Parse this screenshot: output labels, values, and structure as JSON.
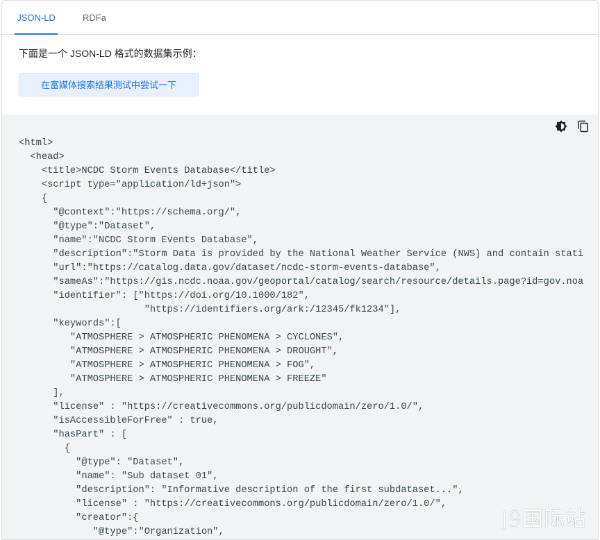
{
  "tabs": [
    {
      "label": "JSON-LD",
      "active": true
    },
    {
      "label": "RDFa",
      "active": false
    }
  ],
  "intro_text": "下面是一个 JSON-LD 格式的数据集示例：",
  "try_button_label": "在富媒体搜索结果测试中尝试一下",
  "toolbar": {
    "theme_icon": "brightness-icon",
    "copy_icon": "copy-icon"
  },
  "code_lines": [
    "<html>",
    "  <head>",
    "    <title>NCDC Storm Events Database</title>",
    "    <script type=\"application/ld+json\">",
    "    {",
    "      \"@context\":\"https://schema.org/\",",
    "      \"@type\":\"Dataset\",",
    "      \"name\":\"NCDC Storm Events Database\",",
    "      \"description\":\"Storm Data is provided by the National Weather Service (NWS) and contain stati",
    "      \"url\":\"https://catalog.data.gov/dataset/ncdc-storm-events-database\",",
    "      \"sameAs\":\"https://gis.ncdc.noaa.gov/geoportal/catalog/search/resource/details.page?id=gov.noa",
    "      \"identifier\": [\"https://doi.org/10.1000/182\",",
    "                      \"https://identifiers.org/ark:/12345/fk1234\"],",
    "      \"keywords\":[",
    "         \"ATMOSPHERE > ATMOSPHERIC PHENOMENA > CYCLONES\",",
    "         \"ATMOSPHERE > ATMOSPHERIC PHENOMENA > DROUGHT\",",
    "         \"ATMOSPHERE > ATMOSPHERIC PHENOMENA > FOG\",",
    "         \"ATMOSPHERE > ATMOSPHERIC PHENOMENA > FREEZE\"",
    "      ],",
    "      \"license\" : \"https://creativecommons.org/publicdomain/zero/1.0/\",",
    "      \"isAccessibleForFree\" : true,",
    "      \"hasPart\" : [",
    "        {",
    "          \"@type\": \"Dataset\",",
    "          \"name\": \"Sub dataset 01\",",
    "          \"description\": \"Informative description of the first subdataset...\",",
    "          \"license\" : \"https://creativecommons.org/publicdomain/zero/1.0/\",",
    "          \"creator\":{",
    "             \"@type\":\"Organization\","
  ],
  "watermark": "J9国际站",
  "colors": {
    "accent": "#1a73e8",
    "code_bg": "#f1f3f4",
    "code_text": "#37474f",
    "button_bg": "#e8f0fe"
  }
}
